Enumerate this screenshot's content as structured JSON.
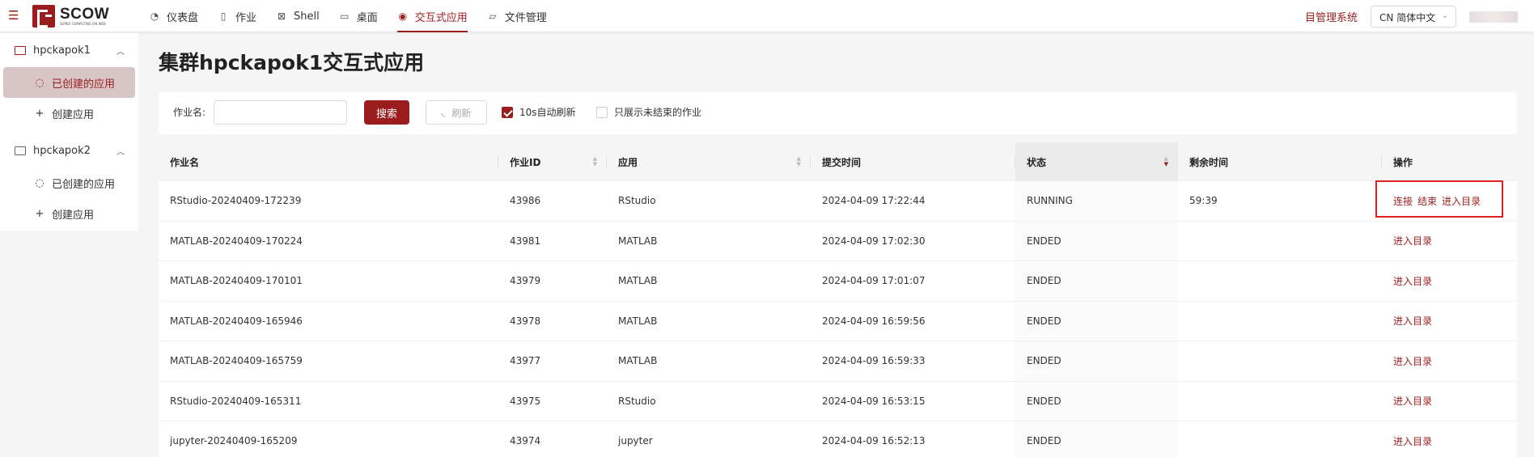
{
  "header": {
    "logo_title": "SCOW",
    "logo_subtitle": "SUPER COMPUTING ON WEB",
    "nav": [
      {
        "label": "仪表盘",
        "icon": "dashboard-icon"
      },
      {
        "label": "作业",
        "icon": "file-icon"
      },
      {
        "label": "Shell",
        "icon": "terminal-icon"
      },
      {
        "label": "桌面",
        "icon": "desktop-icon"
      },
      {
        "label": "交互式应用",
        "icon": "eye-icon"
      },
      {
        "label": "文件管理",
        "icon": "folder-icon"
      }
    ],
    "active_nav": "交互式应用",
    "mgmt_label": "目管理系统",
    "lang_label": "CN 简体中文"
  },
  "sidebar": {
    "groups": [
      {
        "label": "hpckapok1",
        "items": [
          {
            "label": "已创建的应用"
          },
          {
            "label": "创建应用"
          }
        ]
      },
      {
        "label": "hpckapok2",
        "items": [
          {
            "label": "已创建的应用"
          },
          {
            "label": "创建应用"
          }
        ]
      }
    ]
  },
  "main": {
    "title": "集群hpckapok1交互式应用",
    "filter": {
      "job_name_label": "作业名:",
      "search_button": "搜索",
      "refresh_button": "刷新",
      "auto_refresh_label": "10s自动刷新",
      "auto_refresh_checked": true,
      "only_running_label": "只展示未结束的作业",
      "only_running_checked": false
    },
    "table": {
      "columns": [
        "作业名",
        "作业ID",
        "应用",
        "提交时间",
        "状态",
        "剩余时间",
        "操作"
      ],
      "rows": [
        {
          "name": "RStudio-20240409-172239",
          "id": "43986",
          "app": "RStudio",
          "submit": "2024-04-09 17:22:44",
          "status": "RUNNING",
          "remain": "59:39",
          "ops": [
            "连接",
            "结束",
            "进入目录"
          ]
        },
        {
          "name": "MATLAB-20240409-170224",
          "id": "43981",
          "app": "MATLAB",
          "submit": "2024-04-09 17:02:30",
          "status": "ENDED",
          "remain": "",
          "ops": [
            "进入目录"
          ]
        },
        {
          "name": "MATLAB-20240409-170101",
          "id": "43979",
          "app": "MATLAB",
          "submit": "2024-04-09 17:01:07",
          "status": "ENDED",
          "remain": "",
          "ops": [
            "进入目录"
          ]
        },
        {
          "name": "MATLAB-20240409-165946",
          "id": "43978",
          "app": "MATLAB",
          "submit": "2024-04-09 16:59:56",
          "status": "ENDED",
          "remain": "",
          "ops": [
            "进入目录"
          ]
        },
        {
          "name": "MATLAB-20240409-165759",
          "id": "43977",
          "app": "MATLAB",
          "submit": "2024-04-09 16:59:33",
          "status": "ENDED",
          "remain": "",
          "ops": [
            "进入目录"
          ]
        },
        {
          "name": "RStudio-20240409-165311",
          "id": "43975",
          "app": "RStudio",
          "submit": "2024-04-09 16:53:15",
          "status": "ENDED",
          "remain": "",
          "ops": [
            "进入目录"
          ]
        },
        {
          "name": "jupyter-20240409-165209",
          "id": "43974",
          "app": "jupyter",
          "submit": "2024-04-09 16:52:13",
          "status": "ENDED",
          "remain": "",
          "ops": [
            "进入目录"
          ]
        }
      ]
    }
  },
  "colors": {
    "accent": "#9b1c1c",
    "highlight_box": "#e02020"
  }
}
